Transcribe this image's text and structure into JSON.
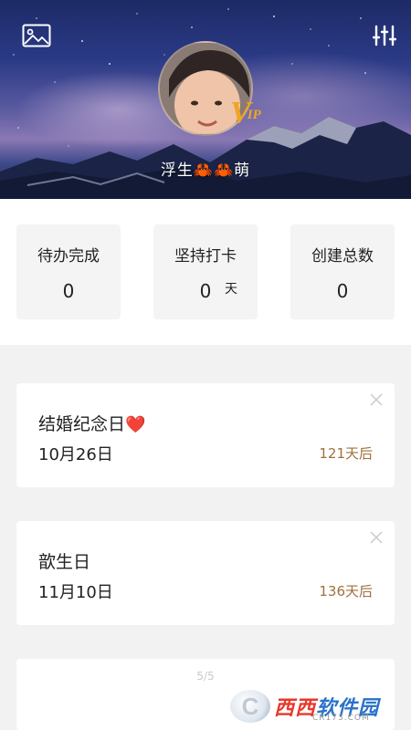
{
  "header": {
    "username": "浮生🦀🦀萌",
    "vip_badge": {
      "v": "V",
      "ip": "IP"
    },
    "left_icon": "image-icon",
    "right_icon": "settings-sliders-icon"
  },
  "stats": [
    {
      "label": "待办完成",
      "value": "0",
      "unit": ""
    },
    {
      "label": "坚持打卡",
      "value": "0",
      "unit": "天"
    },
    {
      "label": "创建总数",
      "value": "0",
      "unit": ""
    }
  ],
  "events": [
    {
      "title": "结婚纪念日",
      "title_suffix": "❤️",
      "date": "10月26日",
      "countdown": "121天后"
    },
    {
      "title": "歆生日",
      "title_suffix": "",
      "date": "11月10日",
      "countdown": "136天后"
    }
  ],
  "pager": "5/5",
  "watermark": {
    "brand_red": "西西",
    "brand_blue": "软件园",
    "url": "CR173.COM"
  },
  "colors": {
    "countdown": "#a0703e",
    "vip": "#f0a523",
    "heart": "#e0262d"
  }
}
